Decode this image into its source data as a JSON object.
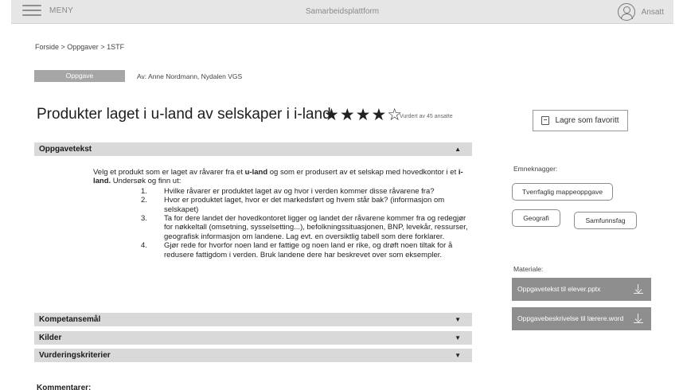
{
  "topbar": {
    "menu_label": "MENY",
    "app_title": "Samarbeidsplattform",
    "user_label": "Ansatt"
  },
  "breadcrumb": {
    "items": [
      "Forside",
      "Oppgaver",
      "1STF"
    ],
    "separator": " > "
  },
  "header": {
    "type_tag": "Oppgave",
    "author": "Av: Anne Nordmann, Nydalen VGS",
    "title": "Produkter laget i u-land av selskaper i i-land",
    "stars_filled": 4,
    "stars_total": 5,
    "rating_text": "Vurdert av 45 ansatte"
  },
  "favorite_button": {
    "label": "Lagre som favoritt"
  },
  "sections": {
    "task": {
      "label": "Oppgavetekst",
      "arrow": "▲"
    },
    "competence": {
      "label": "Kompetansemål",
      "arrow": "▼"
    },
    "sources": {
      "label": "Kilder",
      "arrow": "▼"
    },
    "criteria": {
      "label": "Vurderingskriterier",
      "arrow": "▼"
    }
  },
  "task_text": {
    "intro_part1": "Velg et produkt som er laget av råvarer fra et ",
    "intro_bold1": "u-land",
    "intro_part2": " og som er produsert av et selskap med hovedkontor i et ",
    "intro_bold2": "i-land.",
    "intro_part3": " Undersøk og finn ut:",
    "items": [
      {
        "num": "1.",
        "text": "Hvilke råvarer er produktet laget av og hvor i verden kommer disse råvarene fra?"
      },
      {
        "num": "2.",
        "text": "Hvor er produktet laget, hvor er det markedsført og hvem står bak? (informasjon om selskapet)"
      },
      {
        "num": "3.",
        "text": "Ta for dere landet der hovedkontoret ligger og landet der råvarene kommer fra og redegjør for nøkkeltall (omsetning, sysselsetting...), befolkningssituasjonen, BNP, levekår, ressurser, geografisk informasjon om landene. Lag evt. en oversiktlig tabell som dere forklarer."
      },
      {
        "num": "4.",
        "text": "Gjør rede for hvorfor noen land er fattige og noen land er rike, og drøft noen tiltak for å redusere fattigdom i verden. Bruk landene dere har beskrevet over som eksempler."
      }
    ]
  },
  "sidebar": {
    "tags_label": "Emneknagger:",
    "tags": [
      "Tverrfaglig mappeoppgave",
      "Geografi",
      "Samfunnsfag"
    ],
    "materials_label": "Materiale:",
    "materials": [
      "Oppgavetekst til elever.pptx",
      "Oppgavebeskrivelse til lærere.word"
    ]
  },
  "comments_label": "Kommentarer:"
}
